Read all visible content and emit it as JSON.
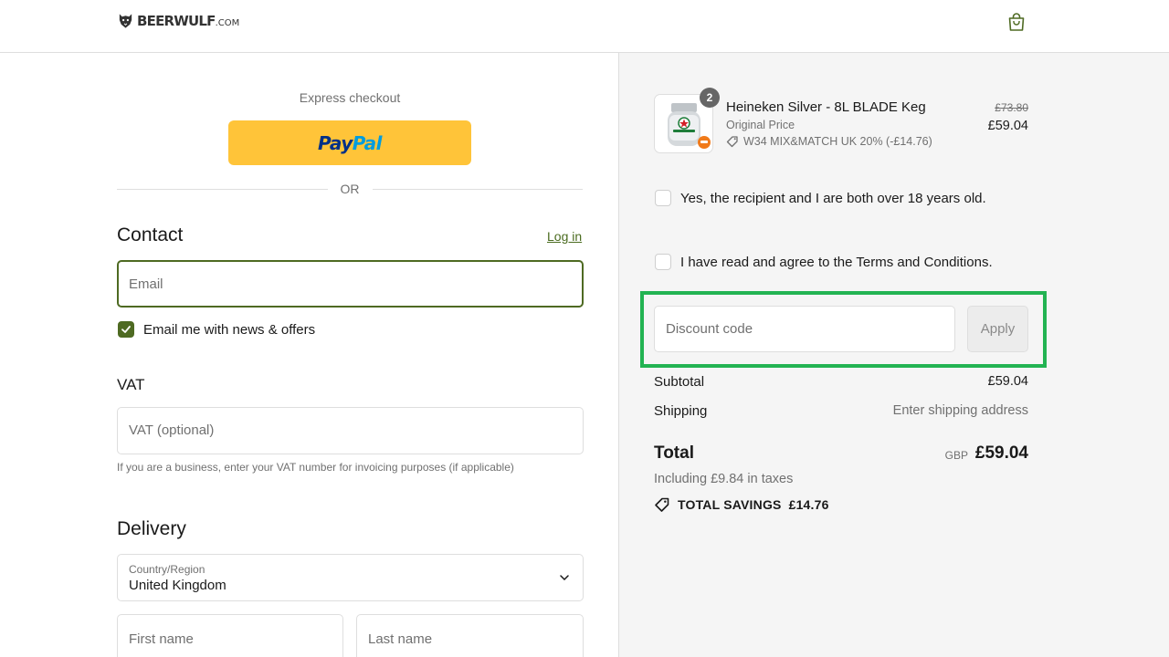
{
  "header": {
    "logo_text": "BEERWULF",
    "logo_suffix": ".COM",
    "cart_icon": "bag-icon"
  },
  "express": {
    "title": "Express checkout",
    "paypal_pay": "Pay",
    "paypal_pal": "Pal",
    "or_text": "OR"
  },
  "contact": {
    "heading": "Contact",
    "login_label": "Log in",
    "email_placeholder": "Email",
    "newsletter_label": "Email me with news & offers",
    "newsletter_checked": true
  },
  "vat": {
    "heading": "VAT",
    "placeholder": "VAT (optional)",
    "help": "If you are a business, enter your VAT number for invoicing purposes (if applicable)"
  },
  "delivery": {
    "heading": "Delivery",
    "country_label": "Country/Region",
    "country_value": "United Kingdom",
    "first_name_placeholder": "First name",
    "last_name_placeholder": "Last name"
  },
  "order": {
    "quantity": "2",
    "product_name": "Heineken Silver - 8L BLADE Keg",
    "product_subtitle": "Original Price",
    "discount_line": "W34 MIX&MATCH UK 20% (-£14.76)",
    "price_old": "£73.80",
    "price_new": "£59.04"
  },
  "consents": {
    "age_label": "Yes, the recipient and I are both over 18 years old.",
    "terms_label": "I have read and agree to the Terms and Conditions."
  },
  "discount": {
    "placeholder": "Discount code",
    "apply_label": "Apply"
  },
  "totals": {
    "subtotal_label": "Subtotal",
    "subtotal_value": "£59.04",
    "shipping_label": "Shipping",
    "shipping_value": "Enter shipping address",
    "total_label": "Total",
    "currency": "GBP",
    "total_value": "£59.04",
    "taxes_text": "Including £9.84 in taxes",
    "savings_label": "TOTAL SAVINGS",
    "savings_value": "£14.76"
  },
  "colors": {
    "accent": "#4e6a22",
    "paypal": "#ffc439",
    "highlight": "#22b352",
    "summary_bg": "#f5f5f5"
  }
}
